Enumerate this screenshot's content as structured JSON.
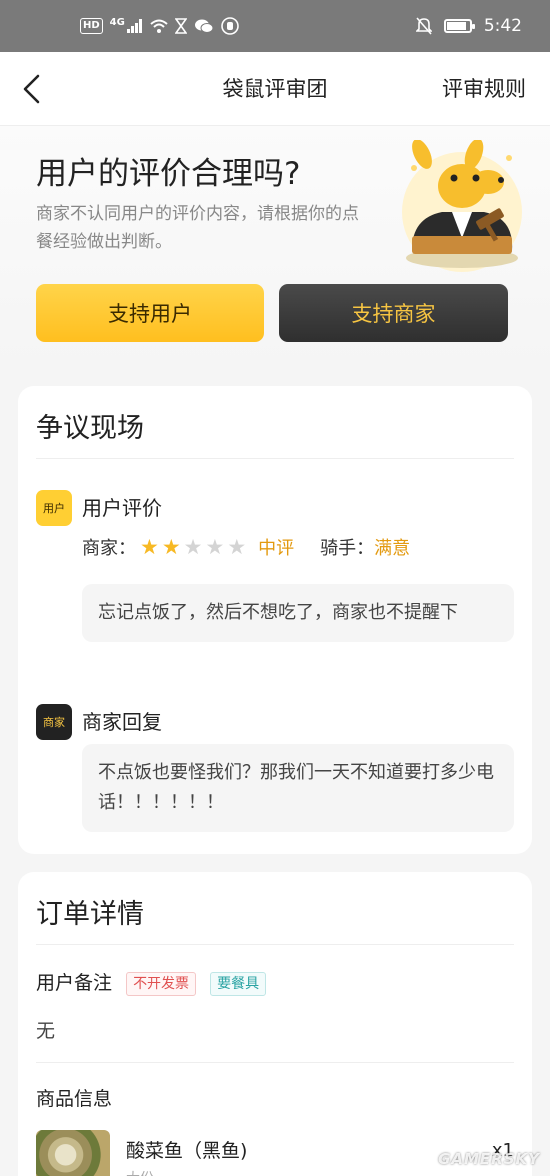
{
  "status_bar": {
    "left_badges": [
      "HD",
      "4G"
    ],
    "left_icons": [
      "signal-icon",
      "wifi-icon",
      "hourglass-icon",
      "wechat-icon",
      "hand-icon"
    ],
    "right_icons": [
      "mute-icon",
      "battery-icon"
    ],
    "battery_level": 0.85,
    "time": "5:42"
  },
  "nav": {
    "back_icon": "back-arrow-icon",
    "title": "袋鼠评审团",
    "rules_link": "评审规则"
  },
  "hero": {
    "title": "用户的评价合理吗?",
    "description": "商家不认同用户的评价内容，请根据你的点餐经验做出判断。",
    "mascot_icon": "kangaroo-judge-icon",
    "support_user_button": "支持用户",
    "support_merchant_button": "支持商家"
  },
  "dispute": {
    "title": "争议现场",
    "user_review": {
      "avatar_text": "用户",
      "label": "用户评价",
      "merchant_prefix": "商家：",
      "stars_filled": 2,
      "stars_total": 5,
      "rating_word": "中评",
      "rider_prefix": "骑手：",
      "rider_rating": "满意",
      "comment": "忘记点饭了，然后不想吃了，商家也不提醒下"
    },
    "merchant_reply": {
      "avatar_text": "商家",
      "label": "商家回复",
      "comment": "不点饭也要怪我们？那我们一天不知道要打多少电话！！！！！！"
    }
  },
  "order": {
    "title": "订单详情",
    "remark_label": "用户备注",
    "remark_tags": [
      "不开发票",
      "要餐具"
    ],
    "remark_value": "无",
    "goods_label": "商品信息",
    "goods": [
      {
        "name": "酸菜鱼（黑鱼)",
        "sub": "大份",
        "qty": "x1"
      }
    ]
  },
  "watermark": "GAMERSKY",
  "colors": {
    "accent_yellow": "#ffcf33",
    "dark_button": "#333333",
    "rating_orange": "#e39a10"
  }
}
